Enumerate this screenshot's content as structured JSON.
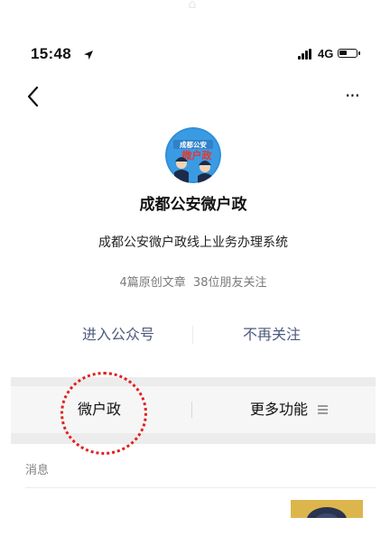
{
  "status": {
    "time": "15:48",
    "network": "4G"
  },
  "nav": {
    "more_label": "···"
  },
  "account": {
    "avatar_text_top": "成都公安",
    "avatar_text_main": "微户政",
    "name": "成都公安微户政",
    "description": "成都公安微户政线上业务办理系统",
    "stats": "4篇原创文章 38位朋友关注"
  },
  "actions": {
    "enter_label": "进入公众号",
    "unfollow_label": "不再关注"
  },
  "menu": {
    "item1_label": "微户政",
    "item2_label": "更多功能"
  },
  "messages": {
    "section_label": "消息"
  },
  "colors": {
    "link": "#4e5a7e",
    "annotation": "#e02020",
    "avatar_bg": "#2e8fd8"
  }
}
